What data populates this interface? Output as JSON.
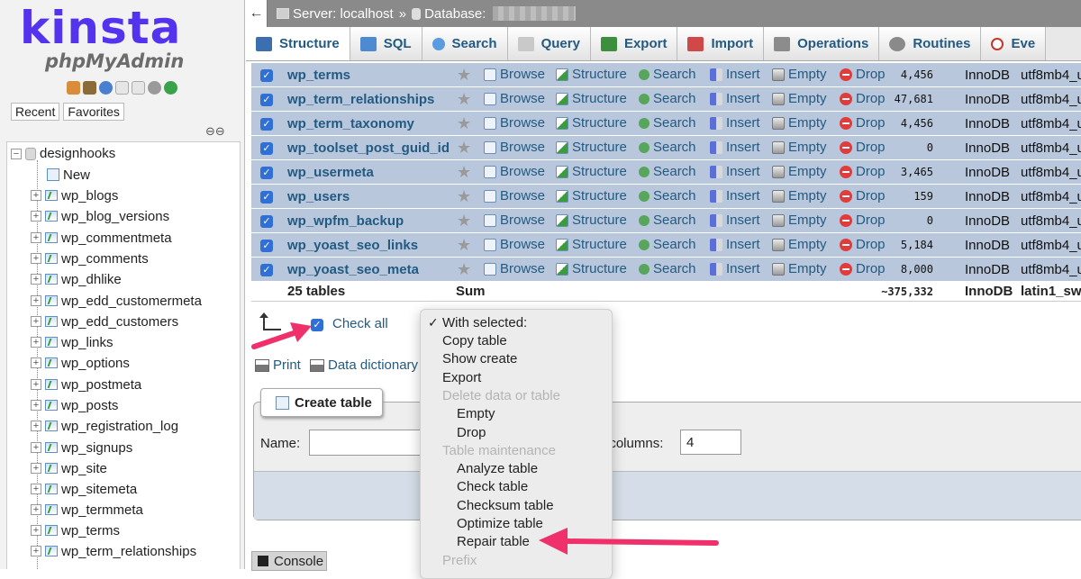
{
  "left": {
    "logo_kinsta": "kinsta",
    "logo_pma": "phpMyAdmin",
    "tabs": [
      "Recent",
      "Favorites"
    ],
    "database": "designhooks",
    "new_label": "New",
    "tables": [
      "wp_blogs",
      "wp_blog_versions",
      "wp_commentmeta",
      "wp_comments",
      "wp_dhlike",
      "wp_edd_customermeta",
      "wp_edd_customers",
      "wp_links",
      "wp_options",
      "wp_postmeta",
      "wp_posts",
      "wp_registration_log",
      "wp_signups",
      "wp_site",
      "wp_sitemeta",
      "wp_termmeta",
      "wp_terms",
      "wp_term_relationships"
    ]
  },
  "breadcrumb": {
    "back": "←",
    "server": "Server: localhost",
    "sep": "»",
    "database": "Database:"
  },
  "tabs": [
    {
      "label": "Structure",
      "icon": "structure-icon",
      "color": "#3b6fb0"
    },
    {
      "label": "SQL",
      "icon": "sql-icon",
      "color": "#4e8ad1"
    },
    {
      "label": "Search",
      "icon": "search-icon",
      "color": "#5b9be0"
    },
    {
      "label": "Query",
      "icon": "query-icon",
      "color": "#9a9a9a"
    },
    {
      "label": "Export",
      "icon": "export-icon",
      "color": "#3c8f3c"
    },
    {
      "label": "Import",
      "icon": "import-icon",
      "color": "#d04848"
    },
    {
      "label": "Operations",
      "icon": "operations-icon",
      "color": "#777777"
    },
    {
      "label": "Routines",
      "icon": "routines-icon",
      "color": "#8a8a8a"
    },
    {
      "label": "Eve",
      "icon": "events-icon",
      "color": "#c0392b"
    }
  ],
  "actions": {
    "browse": "Browse",
    "structure": "Structure",
    "search": "Search",
    "insert": "Insert",
    "empty": "Empty",
    "drop": "Drop"
  },
  "rows": [
    {
      "name": "wp_terms",
      "rows": "4,456",
      "engine": "InnoDB",
      "collation": "utf8mb4_u"
    },
    {
      "name": "wp_term_relationships",
      "rows": "47,681",
      "engine": "InnoDB",
      "collation": "utf8mb4_u"
    },
    {
      "name": "wp_term_taxonomy",
      "rows": "4,456",
      "engine": "InnoDB",
      "collation": "utf8mb4_u"
    },
    {
      "name": "wp_toolset_post_guid_id",
      "rows": "0",
      "engine": "InnoDB",
      "collation": "utf8mb4_u"
    },
    {
      "name": "wp_usermeta",
      "rows": "3,465",
      "engine": "InnoDB",
      "collation": "utf8mb4_u"
    },
    {
      "name": "wp_users",
      "rows": "159",
      "engine": "InnoDB",
      "collation": "utf8mb4_u"
    },
    {
      "name": "wp_wpfm_backup",
      "rows": "0",
      "engine": "InnoDB",
      "collation": "utf8mb4_u"
    },
    {
      "name": "wp_yoast_seo_links",
      "rows": "5,184",
      "engine": "InnoDB",
      "collation": "utf8mb4_u"
    },
    {
      "name": "wp_yoast_seo_meta",
      "rows": "8,000",
      "engine": "InnoDB",
      "collation": "utf8mb4_u"
    }
  ],
  "summary": {
    "tables": "25 tables",
    "sum": "Sum",
    "rows": "~375,332",
    "engine": "InnoDB",
    "collation": "latin1_sw"
  },
  "checkall": "Check all",
  "print": "Print",
  "data_dictionary": "Data dictionary",
  "create": {
    "button": "Create table",
    "name_label": "Name:",
    "cols_label": "f columns:",
    "cols_value": "4"
  },
  "console": "Console",
  "dropdown": {
    "check_mark": "✓",
    "header": "With selected:",
    "items": [
      {
        "label": "Copy table",
        "kind": "item"
      },
      {
        "label": "Show create",
        "kind": "item"
      },
      {
        "label": "Export",
        "kind": "item"
      },
      {
        "label": "Delete data or table",
        "kind": "group"
      },
      {
        "label": "Empty",
        "kind": "sub"
      },
      {
        "label": "Drop",
        "kind": "sub"
      },
      {
        "label": "Table maintenance",
        "kind": "group"
      },
      {
        "label": "Analyze table",
        "kind": "sub"
      },
      {
        "label": "Check table",
        "kind": "sub"
      },
      {
        "label": "Checksum table",
        "kind": "sub"
      },
      {
        "label": "Optimize table",
        "kind": "sub"
      },
      {
        "label": "Repair table",
        "kind": "sub"
      },
      {
        "label": "Prefix",
        "kind": "group"
      }
    ]
  },
  "annotation_color": "#f0306a"
}
